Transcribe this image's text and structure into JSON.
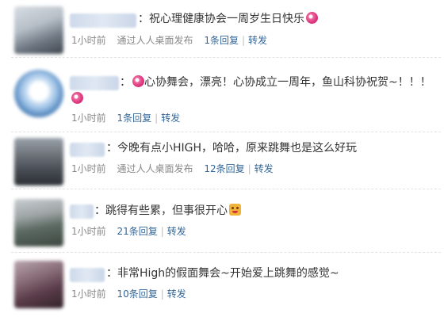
{
  "posts": [
    {
      "text": "：祝心理健康协会一周岁生日快乐",
      "emoji_after": "pink-flower-icon",
      "time": "1小时前",
      "source": "通过人人桌面发布",
      "reply": "1条回复",
      "share": "转发"
    },
    {
      "text_line1": "：",
      "text_line1_rest": "心协舞会，漂亮！心协成立一周年，鱼山科协祝贺~！！！",
      "time": "1小时前",
      "reply": "1条回复",
      "share": "转发"
    },
    {
      "text": "：今晚有点小HIGH，哈哈，原来跳舞也是这么好玩",
      "time": "1小时前",
      "source": "通过人人桌面发布",
      "reply": "12条回复",
      "share": "转发"
    },
    {
      "text": "：跳得有些累，但事很开心",
      "emoji_after": "smiling-face-icon",
      "time": "1小时前",
      "reply": "21条回复",
      "share": "转发"
    },
    {
      "text": "：非常High的假面舞会~开始爱上跳舞的感觉~",
      "time": "1小时前",
      "reply": "10条回复",
      "share": "转发"
    }
  ],
  "colors": {
    "link": "#336699",
    "meta": "#888888",
    "text": "#333333"
  }
}
